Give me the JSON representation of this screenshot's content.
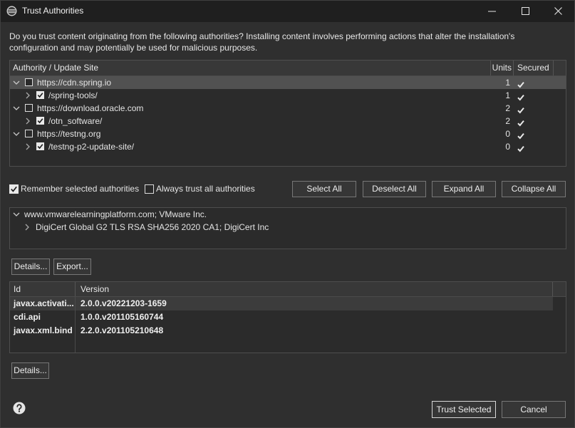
{
  "window": {
    "title": "Trust Authorities",
    "app_icon": "eclipse-icon",
    "controls": [
      "minimize-icon",
      "maximize-icon",
      "close-icon"
    ]
  },
  "description": [
    "Do you trust content originating from the following authorities?  Installing content involves performing actions that alter the installation's",
    "configuration and may potentially be used for malicious purposes."
  ],
  "authorities": {
    "columns": {
      "site": "Authority / Update Site",
      "units": "Units",
      "secured": "Secured"
    },
    "rows": [
      {
        "site": "https://cdn.spring.io",
        "checked": false,
        "expanded": true,
        "selected": true,
        "units": 1,
        "secured": true,
        "children": [
          {
            "site": "/spring-tools/",
            "checked": true,
            "expanded": false,
            "units": 1,
            "secured": true
          }
        ]
      },
      {
        "site": "https://download.oracle.com",
        "checked": false,
        "expanded": true,
        "selected": false,
        "units": 2,
        "secured": true,
        "children": [
          {
            "site": "/otn_software/",
            "checked": true,
            "expanded": false,
            "units": 2,
            "secured": true
          }
        ]
      },
      {
        "site": "https://testng.org",
        "checked": false,
        "expanded": true,
        "selected": false,
        "units": 0,
        "secured": true,
        "children": [
          {
            "site": "/testng-p2-update-site/",
            "checked": true,
            "expanded": false,
            "units": 0,
            "secured": true
          }
        ]
      }
    ]
  },
  "options": {
    "remember": {
      "label": "Remember selected authorities",
      "checked": true
    },
    "always_trust": {
      "label": "Always trust all authorities",
      "checked": false
    }
  },
  "tree_buttons": {
    "select_all": "Select All",
    "deselect_all": "Deselect All",
    "expand_all": "Expand All",
    "collapse_all": "Collapse All"
  },
  "certificates": [
    {
      "label": "www.vmwarelearningplatform.com; VMware Inc.",
      "expanded": true,
      "children": [
        {
          "label": "DigiCert Global G2 TLS RSA SHA256 2020 CA1; DigiCert Inc",
          "expanded": false
        }
      ]
    }
  ],
  "certificate_buttons": {
    "details": "Details...",
    "export": "Export..."
  },
  "units": {
    "columns": {
      "id": "Id",
      "version": "Version"
    },
    "rows": [
      {
        "id": "javax.activati...",
        "version": "2.0.0.v20221203-1659",
        "highlighted": true
      },
      {
        "id": "cdi.api",
        "version": "1.0.0.v201105160744",
        "highlighted": false
      },
      {
        "id": "javax.xml.bind",
        "version": "2.2.0.v201105210648",
        "highlighted": false
      }
    ]
  },
  "unit_buttons": {
    "details": "Details..."
  },
  "footer": {
    "help_icon": "help-icon",
    "trust_selected": "Trust Selected",
    "cancel": "Cancel"
  },
  "colors": {
    "dialog_background": "#2f2f2f",
    "title_bar": "#1f1f1f",
    "text": "#e4e4e4",
    "selection": "#515151",
    "default_button_border": "#d8d8d8"
  }
}
